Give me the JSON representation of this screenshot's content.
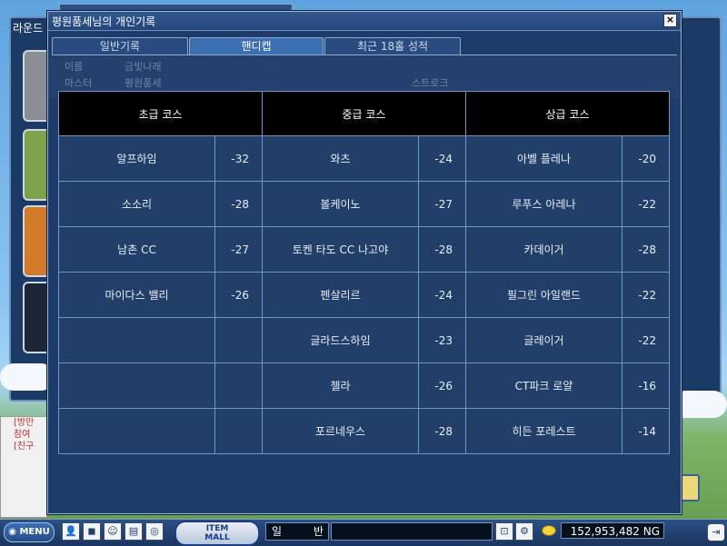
{
  "window": {
    "title": "평원품세님의 개인기록",
    "close_label": "×"
  },
  "tabs": [
    {
      "label": "일반기록"
    },
    {
      "label": "핸디캡"
    },
    {
      "label": "최근 18홀 성적"
    }
  ],
  "active_tab": "핸디캡",
  "background": {
    "lobby_title": "라운드",
    "faded_texts": [
      "이름",
      "금빛나래",
      "마스터",
      "평원품세",
      "스트로크"
    ],
    "chat_lines": [
      "[방만",
      "참여",
      "[친구"
    ]
  },
  "handicap_table": {
    "headers": [
      "초급 코스",
      "중급 코스",
      "상급 코스"
    ],
    "rows": [
      [
        {
          "name": "알프하임",
          "value": "-32"
        },
        {
          "name": "와츠",
          "value": "-24"
        },
        {
          "name": "아벨 플레나",
          "value": "-20"
        }
      ],
      [
        {
          "name": "소소리",
          "value": "-28"
        },
        {
          "name": "볼케이노",
          "value": "-27"
        },
        {
          "name": "루푸스 아레나",
          "value": "-22"
        }
      ],
      [
        {
          "name": "남촌 CC",
          "value": "-27"
        },
        {
          "name": "토켄 타도 CC 나고야",
          "value": "-28"
        },
        {
          "name": "카데이거",
          "value": "-28"
        }
      ],
      [
        {
          "name": "마이다스 밸리",
          "value": "-26"
        },
        {
          "name": "펜살리르",
          "value": "-24"
        },
        {
          "name": "필그린 아일랜드",
          "value": "-22"
        }
      ],
      [
        {
          "name": "",
          "value": ""
        },
        {
          "name": "글라드스하임",
          "value": "-23"
        },
        {
          "name": "글레이거",
          "value": "-22"
        }
      ],
      [
        {
          "name": "",
          "value": ""
        },
        {
          "name": "첼라",
          "value": "-26"
        },
        {
          "name": "CT파크 로얄",
          "value": "-16"
        }
      ],
      [
        {
          "name": "",
          "value": ""
        },
        {
          "name": "포르네우스",
          "value": "-28"
        },
        {
          "name": "히든 포레스트",
          "value": "-14"
        }
      ]
    ]
  },
  "bottombar": {
    "menu_label": "MENU",
    "item_mall_line1": "ITEM",
    "item_mall_line2": "MALL",
    "channel_part1": "일",
    "channel_part2": "반",
    "ng_amount": "152,953,482 NG"
  },
  "icons": {
    "close": "close-icon",
    "menu": "menu-icon",
    "exit": "exit-icon",
    "gold": "gold-coin-icon"
  },
  "colors": {
    "window_bg": "#1d3c6a",
    "header_bg": "#000000",
    "cell_bg": "#223f6a",
    "grid_line": "#6f95c8",
    "active_tab": "#3e6fb0"
  }
}
